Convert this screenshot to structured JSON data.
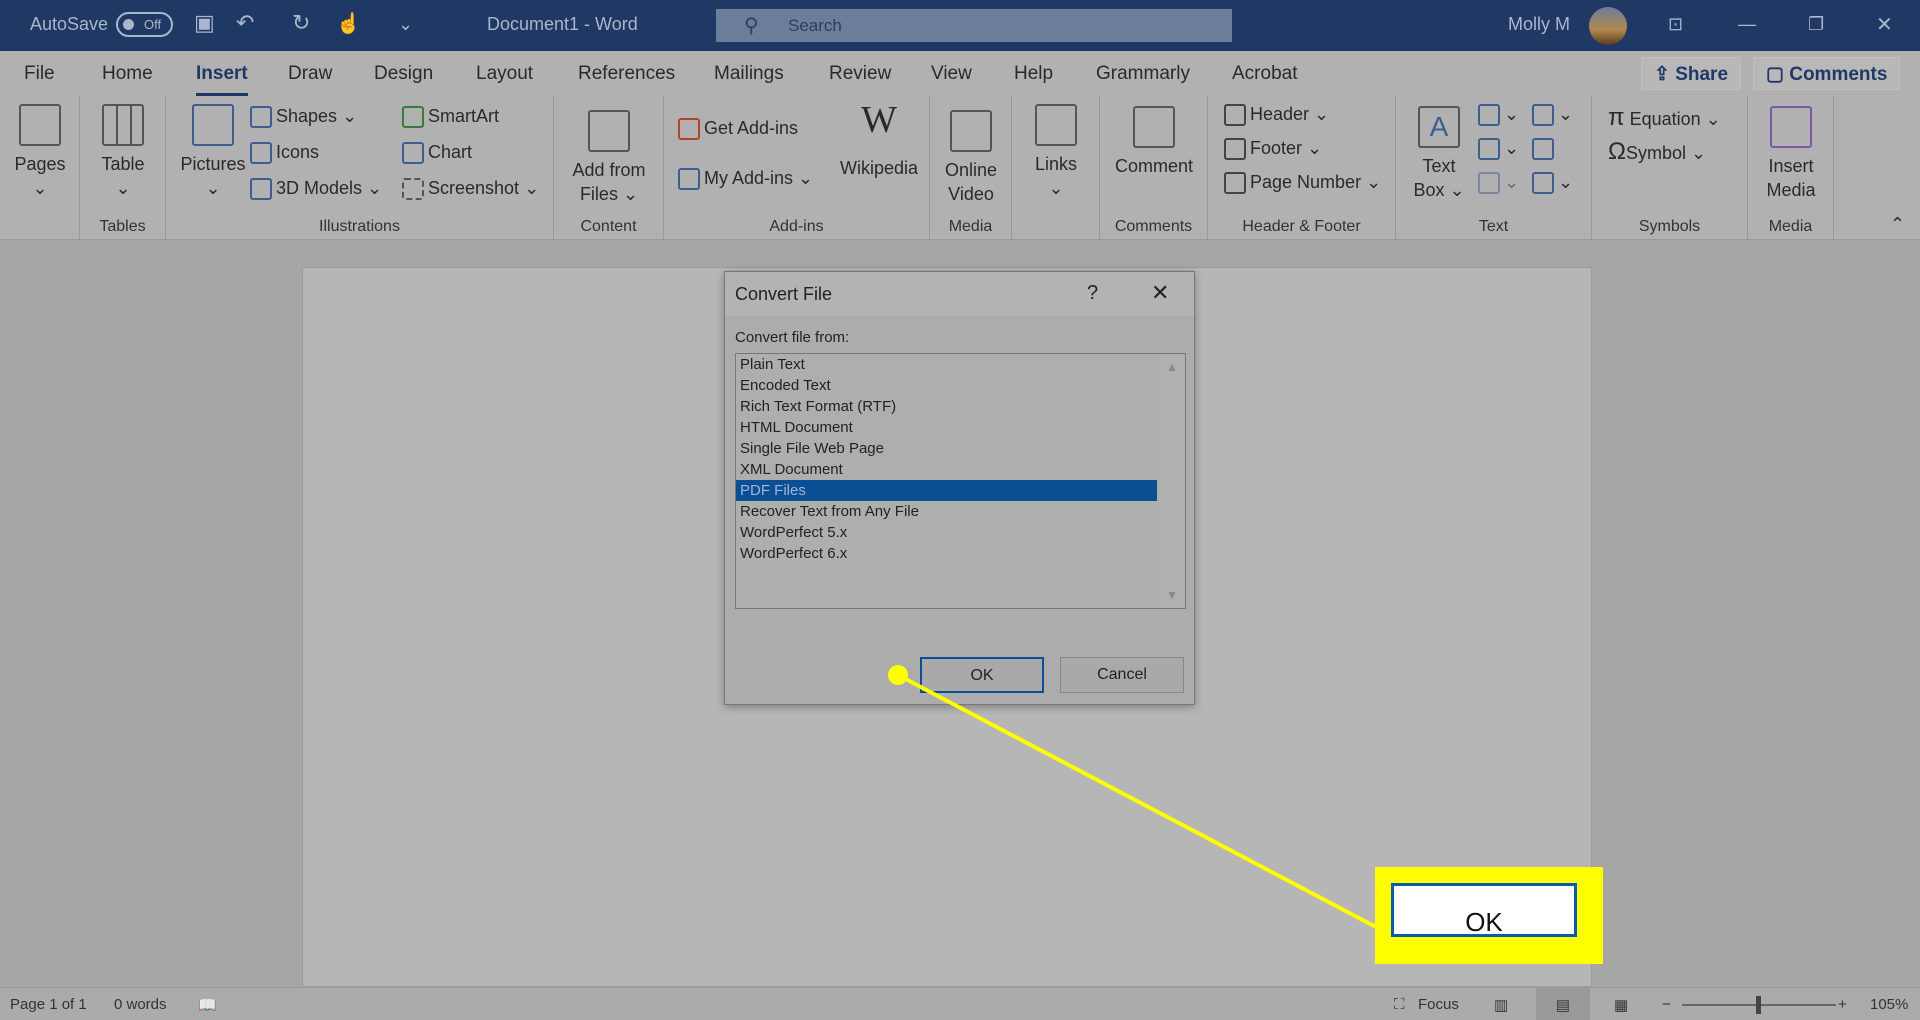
{
  "titlebar": {
    "autosave": "AutoSave",
    "toggle": "Off",
    "doc_title": "Document1  -  Word",
    "search_placeholder": "Search",
    "user": "Molly M"
  },
  "tabs": [
    "File",
    "Home",
    "Insert",
    "Draw",
    "Design",
    "Layout",
    "References",
    "Mailings",
    "Review",
    "View",
    "Help",
    "Grammarly",
    "Acrobat"
  ],
  "active_tab": "Insert",
  "share": "Share",
  "comments": "Comments",
  "ribbon": {
    "pages": "Pages",
    "tables": {
      "table": "Table",
      "label": "Tables"
    },
    "illustrations": {
      "pictures": "Pictures",
      "shapes": "Shapes",
      "icons": "Icons",
      "models": "3D Models",
      "smartart": "SmartArt",
      "chart": "Chart",
      "screenshot": "Screenshot",
      "label": "Illustrations"
    },
    "content": {
      "add1": "Add from",
      "add2": "Files",
      "label": "Content"
    },
    "addins": {
      "get": "Get Add-ins",
      "my": "My Add-ins",
      "wiki": "Wikipedia",
      "label": "Add-ins"
    },
    "media": {
      "v1": "Online",
      "v2": "Video",
      "label": "Media"
    },
    "links": "Links",
    "comments": {
      "comment": "Comment",
      "label": "Comments"
    },
    "hf": {
      "header": "Header",
      "footer": "Footer",
      "page_number": "Page Number",
      "label": "Header & Footer"
    },
    "text": {
      "t1": "Text",
      "t2": "Box",
      "label": "Text"
    },
    "symbols": {
      "equation": "Equation",
      "symbol": "Symbol",
      "label": "Symbols"
    },
    "media2": {
      "i1": "Insert",
      "i2": "Media",
      "label": "Media"
    }
  },
  "dialog": {
    "title": "Convert File",
    "help": "?",
    "prompt": "Convert file from:",
    "items": [
      "Plain Text",
      "Encoded Text",
      "Rich Text Format (RTF)",
      "HTML Document",
      "Single File Web Page",
      "XML Document",
      "PDF Files",
      "Recover Text from Any File",
      "WordPerfect 5.x",
      "WordPerfect 6.x"
    ],
    "selected": "PDF Files",
    "ok": "OK",
    "cancel": "Cancel"
  },
  "callout": {
    "label": "OK",
    "color": "#ffff00"
  },
  "status": {
    "page": "Page 1 of 1",
    "words": "0 words",
    "focus": "Focus",
    "zoom": "105%"
  }
}
